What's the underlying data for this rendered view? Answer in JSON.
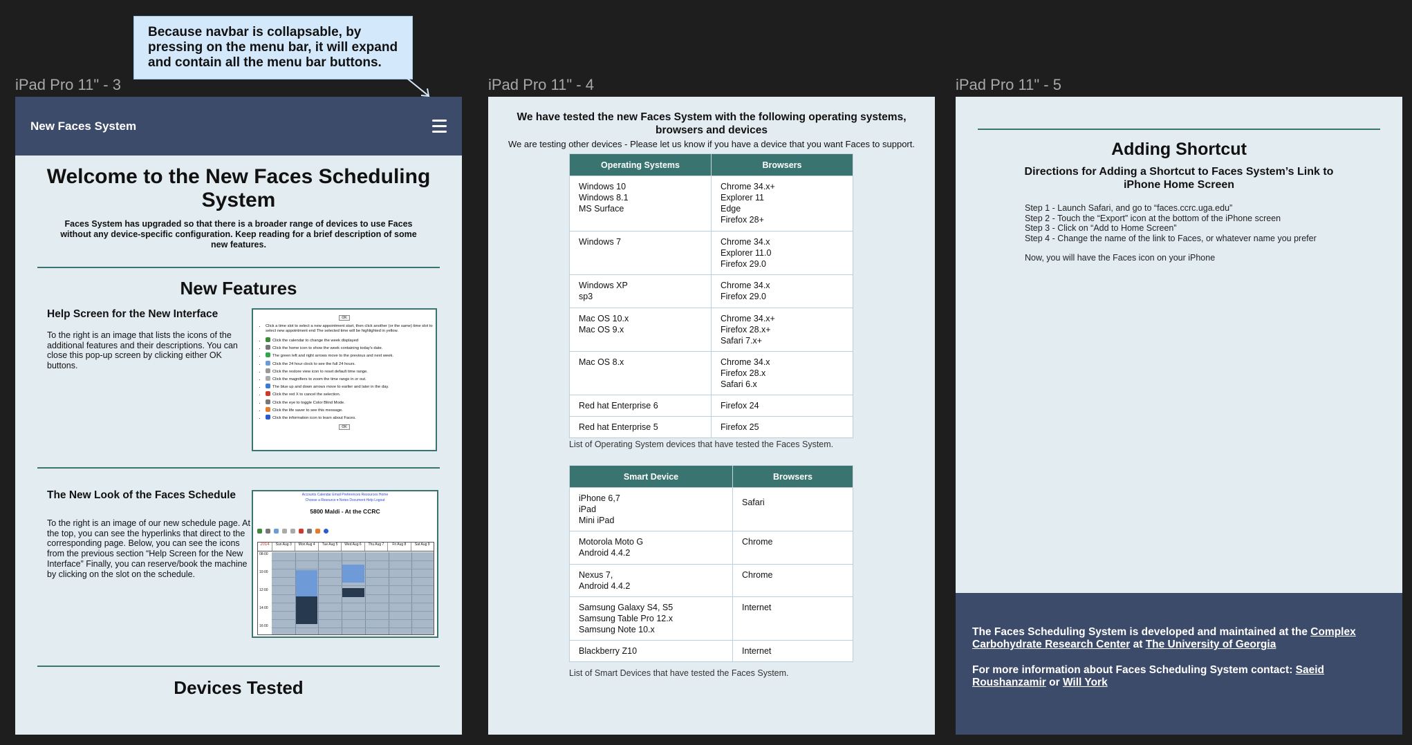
{
  "annotation": {
    "text": "Because navbar is collapsable, by pressing on the menu bar, it will expand and contain all the menu bar buttons."
  },
  "frames": [
    {
      "label": "iPad Pro 11\" - 3"
    },
    {
      "label": "iPad Pro 11\" - 4"
    },
    {
      "label": "iPad Pro 11\" - 5"
    }
  ],
  "frame1": {
    "brand": "New Faces System",
    "hero_title": "Welcome to the New Faces Scheduling System",
    "hero_text": "Faces System has upgraded so that there is a broader range of devices to use Faces without any device-specific configuration. Keep reading for a brief description of some new features.",
    "new_features_title": "New Features",
    "feature1": {
      "title": "Help Screen for the New Interface",
      "text": "To the right is an image that lists the icons of the additional features and their descriptions. You can close this pop-up screen by clicking either OK buttons."
    },
    "feature2": {
      "title": "The New Look of the Faces Schedule",
      "text": "To the right is an image of our new schedule page. At the top, you can see the hyperlinks that direct to the corresponding page. Below, you can see the icons from the previous section “Help Screen for the New Interface” Finally, you can reserve/book the machine by clicking on the slot on the schedule."
    },
    "devices_title": "Devices Tested",
    "help_screen": {
      "ok": "OK",
      "items": [
        "Click a time slot to select a new appointment start, then click another (or the same) time slot to select new appointment end The selected time will be highlighted in yellow.",
        "Click the calendar to change the week displayed",
        "Click the home icon to show the week containing today's date.",
        "The green left and right arrows move to the previous and next week.",
        "Click the 24 hour clock to see the full 24 hours.",
        "Click the restore view icon to reset default time range.",
        "Click the magnifiers to zoom the time range in or out.",
        "The blue up and down arrows move to earlier and later in the day.",
        "Click the red X to cancel the selection.",
        "Click the eye to toggle Color Blind Mode.",
        "Click the life saver to see this message.",
        "Click the information icon to learn about Faces."
      ]
    },
    "schedule_screen": {
      "links": "Accounts   Calendar   Email   Preferences   Resources   Home",
      "sublinks": "Choose a Resource ▾   Notes   Document   Help   Logout",
      "title": "5800 Maldi - At the CCRC",
      "year": "2014",
      "days": [
        "Sun Aug 3",
        "Mon Aug 4",
        "Tue Aug 5",
        "Wed Aug 6",
        "Thu Aug 7",
        "Fri Aug 8",
        "Sat Aug 9"
      ],
      "times": [
        "08:00",
        "10:00",
        "12:00",
        "14:00",
        "16:00"
      ]
    }
  },
  "frame2": {
    "title": "We have tested the new Faces System with the following operating systems, browsers and devices",
    "subtitle": "We are testing other devices - Please let us know if you have a device that you want Faces to support.",
    "os_table": {
      "headers": [
        "Operating Systems",
        "Browsers"
      ],
      "rows": [
        {
          "os": "Windows 10\nWindows 8.1\nMS Surface",
          "browsers": "Chrome 34.x+\nExplorer 11\nEdge\nFirefox 28+"
        },
        {
          "os": "Windows 7",
          "browsers": "Chrome 34.x\nExplorer 11.0\nFirefox 29.0"
        },
        {
          "os": "Windows XP\nsp3",
          "browsers": "Chrome 34.x\nFirefox 29.0"
        },
        {
          "os": "Mac OS 10.x\nMac OS 9.x",
          "browsers": "Chrome 34.x+\nFirefox 28.x+\nSafari 7.x+"
        },
        {
          "os": "Mac OS 8.x",
          "browsers": "Chrome 34.x\nFirefox 28.x\nSafari 6.x"
        },
        {
          "os": "Red hat Enterprise 6",
          "browsers": "Firefox 24"
        },
        {
          "os": "Red hat Enterprise 5",
          "browsers": "Firefox 25"
        }
      ],
      "caption": "List of Operating System devices that have tested the Faces System."
    },
    "device_table": {
      "headers": [
        "Smart Device",
        "Browsers"
      ],
      "rows": [
        {
          "device": "iPhone 6,7\niPad\nMini iPad",
          "browsers": "Safari"
        },
        {
          "device": "Motorola Moto G\nAndroid 4.4.2",
          "browsers": "Chrome"
        },
        {
          "device": "Nexus 7,\nAndroid 4.4.2",
          "browsers": "Chrome"
        },
        {
          "device": "Samsung Galaxy S4, S5\nSamsung Table Pro 12.x\nSamsung Note 10.x",
          "browsers": "Internet"
        },
        {
          "device": "Blackberry Z10",
          "browsers": "Internet"
        }
      ],
      "caption": "List of Smart Devices that have tested the Faces System."
    }
  },
  "frame3": {
    "title": "Adding Shortcut",
    "subtitle": "Directions for Adding a Shortcut to Faces System’s Link to iPhone Home Screen",
    "steps": [
      "Step 1 - Launch Safari, and go to “faces.ccrc.uga.edu”",
      "Step 2 - Touch the “Export” icon at the bottom of the iPhone screen",
      "Step 3 - Click on “Add to Home Screen”",
      "Step 4 - Change the name of the link to Faces, or whatever name you prefer"
    ],
    "closing": "Now, you will have the Faces icon on your iPhone",
    "footer": {
      "line1_prefix": "The Faces Scheduling System is developed and maintained at the ",
      "ccrc_link": "Complex Carbohydrate Research Center",
      "line1_mid": " at ",
      "uga_link": "The University of Georgia",
      "line2_prefix": "For more information about Faces Scheduling System contact: ",
      "contact1": "Saeid Roushanzamir",
      "line2_mid": " or ",
      "contact2": "Will York"
    }
  }
}
